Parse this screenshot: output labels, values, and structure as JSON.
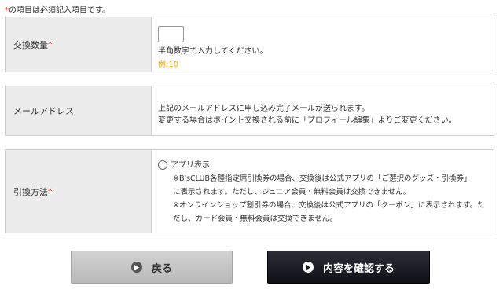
{
  "note": {
    "marker": "*",
    "text": "の項目は必須記入項目です。"
  },
  "quantity": {
    "label": "交換数量",
    "required_mark": "*",
    "value": "",
    "hint": "半角数字で入力してください。",
    "example": "例:10"
  },
  "email": {
    "label": "メールアドレス",
    "line1": "上記のメールアドレスに申し込み完了メールが送られます。",
    "line2": "変更する場合はポイント交換される前に「プロフィール編集」よりご変更ください。"
  },
  "redeem": {
    "label": "引換方法",
    "required_mark": "*",
    "option_label": "アプリ表示",
    "note1a": "※B'sCLUB各種指定席引換券の場合、交換後は公式アプリの「ご選択のグッズ・引換券」",
    "note1b": "に表示されます。ただし、ジュニア会員・無料会員は交換できません。",
    "note2a": "※オンラインショップ割引券の場合、交換後は公式アプリの「クーポン」に表示されます。た",
    "note2b": "だし、カード会員・無料会員は交換できません。"
  },
  "buttons": {
    "back": "戻る",
    "confirm": "内容を確認する"
  },
  "colors": {
    "required": "#d9261c",
    "example": "#e6a000",
    "confirm_bg": "#1a1a22",
    "back_bg": "#c4c4c4"
  },
  "icons": {
    "back": "play-circle-icon",
    "confirm": "play-circle-icon"
  }
}
